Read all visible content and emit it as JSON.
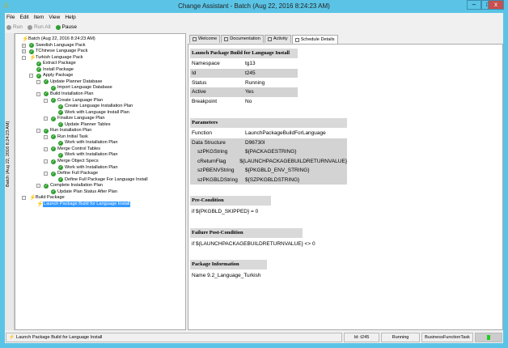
{
  "window": {
    "title": "Change Assistant - Batch (Aug 22, 2016 8:24:23 AM)",
    "minimize": "–",
    "maximize": "□",
    "close": "x"
  },
  "menu": [
    "File",
    "Edit",
    "Item",
    "View",
    "Help"
  ],
  "toolbar": [
    {
      "label": "Run",
      "enabled": false
    },
    {
      "label": "Run All",
      "enabled": false
    },
    {
      "label": "Pause",
      "enabled": true
    }
  ],
  "side_tab": "Batch (Aug 22, 2016 8:24:23 AM)",
  "tree": [
    {
      "label": "Batch (Aug 22, 2016 8:24:23 AM)",
      "level": 0,
      "icon": "bolt",
      "exp": ""
    },
    {
      "label": "Swedish Language Pack",
      "level": 1,
      "icon": "check",
      "exp": "+"
    },
    {
      "label": "TChinese Language Pack",
      "level": 1,
      "icon": "check",
      "exp": "+"
    },
    {
      "label": "Turkish Language Pack",
      "level": 1,
      "icon": "bolt",
      "exp": "-"
    },
    {
      "label": "Extract Package",
      "level": 2,
      "icon": "check",
      "exp": ""
    },
    {
      "label": "Install Package",
      "level": 2,
      "icon": "check",
      "exp": ""
    },
    {
      "label": "Apply Package",
      "level": 2,
      "icon": "check",
      "exp": "-"
    },
    {
      "label": "Update Planner Database",
      "level": 3,
      "icon": "check",
      "exp": "-"
    },
    {
      "label": "Import Language Database",
      "level": 4,
      "icon": "check",
      "exp": ""
    },
    {
      "label": "Build Installation Plan",
      "level": 3,
      "icon": "check",
      "exp": "-"
    },
    {
      "label": "Create Language Plan",
      "level": 4,
      "icon": "check",
      "exp": "-"
    },
    {
      "label": "Create Language Installation Plan",
      "level": 5,
      "icon": "check",
      "exp": ""
    },
    {
      "label": "Work with Language Install Plan",
      "level": 5,
      "icon": "check",
      "exp": ""
    },
    {
      "label": "Finalize Language Plan",
      "level": 4,
      "icon": "check",
      "exp": "-"
    },
    {
      "label": "Update Planner Tables",
      "level": 5,
      "icon": "check",
      "exp": ""
    },
    {
      "label": "Run Installation Plan",
      "level": 3,
      "icon": "check",
      "exp": "-"
    },
    {
      "label": "Run Initial Task",
      "level": 4,
      "icon": "check",
      "exp": "-"
    },
    {
      "label": "Work with Installation Plan",
      "level": 5,
      "icon": "check",
      "exp": ""
    },
    {
      "label": "Merge Control Tables",
      "level": 4,
      "icon": "check",
      "exp": "-"
    },
    {
      "label": "Work with Installation Plan",
      "level": 5,
      "icon": "check",
      "exp": ""
    },
    {
      "label": "Merge Object Specs",
      "level": 4,
      "icon": "check",
      "exp": "-"
    },
    {
      "label": "Work with Installation Plan",
      "level": 5,
      "icon": "check",
      "exp": ""
    },
    {
      "label": "Define Full Package",
      "level": 4,
      "icon": "check",
      "exp": "-"
    },
    {
      "label": "Define Full Package For Language Install",
      "level": 5,
      "icon": "check",
      "exp": ""
    },
    {
      "label": "Complete Installation Plan",
      "level": 3,
      "icon": "check",
      "exp": "-"
    },
    {
      "label": "Update Plan Status After Plan",
      "level": 4,
      "icon": "check",
      "exp": ""
    },
    {
      "label": "Build Package",
      "level": 1,
      "icon": "bolt",
      "exp": "-"
    },
    {
      "label": "Launch Package Build for Language Install",
      "level": 2,
      "icon": "bolt",
      "exp": "",
      "selected": true
    }
  ],
  "tabs": [
    {
      "label": "Welcome"
    },
    {
      "label": "Documentation"
    },
    {
      "label": "Activity"
    },
    {
      "label": "Schedule Details",
      "active": true
    }
  ],
  "details": {
    "title": "Launch Package Build for Language Install",
    "props": [
      [
        "Namespace",
        "tg13"
      ],
      [
        "Id",
        "t245"
      ],
      [
        "Status",
        "Running"
      ],
      [
        "Active",
        "Yes"
      ],
      [
        "Breakpoint",
        "No"
      ]
    ],
    "parameters_header": "Parameters",
    "function": [
      "Function",
      "LaunchPackageBuildForLanguage"
    ],
    "data_structure": [
      "Data Structure",
      "D96730I"
    ],
    "params": [
      [
        "szPKGString",
        "${PACKAGESTRING}"
      ],
      [
        "cReturnFlag",
        "${LAUNCHPACKAGEBUILDRETURNVALUE}"
      ],
      [
        "szPBENVString",
        "${PKGBLD_ENV_STRING}"
      ],
      [
        "szPKGBLDString",
        "${SZPKGBLDSTRING}"
      ]
    ],
    "pre_header": "Pre-Condition",
    "pre": "if ${PKGBLD_SKIPPED} = 0",
    "fail_header": "Failure Post-Condition",
    "fail": "if ${LAUNCHPACKAGEBUILDRETURNVALUE} <> 0",
    "pkg_header": "Package Information",
    "pkg_name": "Name  9.2_Language_Turkish"
  },
  "status": {
    "text": "Launch Package Build for Language Install",
    "id": "Id: t245",
    "state": "Running",
    "type": "BusinessFunctionTask"
  }
}
